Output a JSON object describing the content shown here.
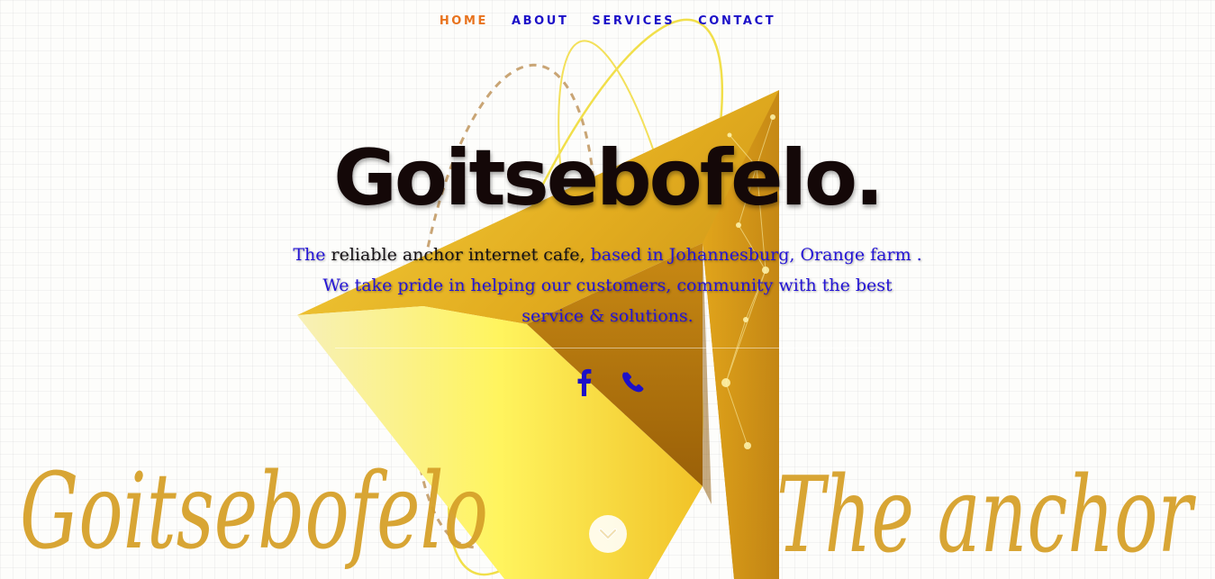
{
  "nav": {
    "items": [
      {
        "label": "HOME",
        "active": true
      },
      {
        "label": "ABOUT",
        "active": false
      },
      {
        "label": "SERVICES",
        "active": false
      },
      {
        "label": "CONTACT",
        "active": false
      }
    ]
  },
  "hero": {
    "title": "Goitsebofelo.",
    "tagline_part1": "The ",
    "tagline_part2": "reliable anchor internet cafe,",
    "tagline_part3": " based in Johannesburg, Orange farm . We take pride in helping our customers, community with the best service & solutions."
  },
  "background": {
    "script_left": "Goitsebofelo",
    "script_right": "The anchor"
  },
  "socials": {
    "items": [
      {
        "icon": "facebook-icon"
      },
      {
        "icon": "phone-icon"
      }
    ]
  },
  "colors": {
    "nav_link": "#1c10c8",
    "nav_active": "#e8731e",
    "title": "#140808",
    "tagline": "#2414d6",
    "gold": "#d9a21b"
  }
}
